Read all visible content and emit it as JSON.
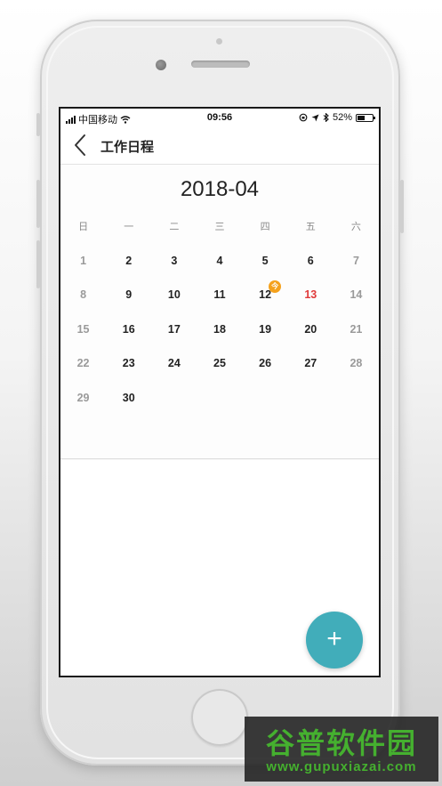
{
  "status_bar": {
    "carrier": "中国移动",
    "time": "09:56",
    "battery": "52%",
    "battery_level": 0.52
  },
  "nav": {
    "title": "工作日程"
  },
  "calendar": {
    "month": "2018-04",
    "weekdays": [
      "日",
      "一",
      "二",
      "三",
      "四",
      "五",
      "六"
    ],
    "weeks": [
      [
        {
          "d": "1",
          "s": "muted"
        },
        {
          "d": "2"
        },
        {
          "d": "3"
        },
        {
          "d": "4"
        },
        {
          "d": "5"
        },
        {
          "d": "6"
        },
        {
          "d": "7",
          "s": "muted"
        }
      ],
      [
        {
          "d": "8",
          "s": "muted"
        },
        {
          "d": "9"
        },
        {
          "d": "10"
        },
        {
          "d": "11"
        },
        {
          "d": "12",
          "badge": "今"
        },
        {
          "d": "13",
          "s": "red"
        },
        {
          "d": "14",
          "s": "muted"
        }
      ],
      [
        {
          "d": "15",
          "s": "muted"
        },
        {
          "d": "16"
        },
        {
          "d": "17"
        },
        {
          "d": "18"
        },
        {
          "d": "19"
        },
        {
          "d": "20"
        },
        {
          "d": "21",
          "s": "muted"
        }
      ],
      [
        {
          "d": "22",
          "s": "muted"
        },
        {
          "d": "23"
        },
        {
          "d": "24"
        },
        {
          "d": "25"
        },
        {
          "d": "26"
        },
        {
          "d": "27"
        },
        {
          "d": "28",
          "s": "muted"
        }
      ],
      [
        {
          "d": "29",
          "s": "muted"
        },
        {
          "d": "30"
        },
        {
          "d": ""
        },
        {
          "d": ""
        },
        {
          "d": ""
        },
        {
          "d": ""
        },
        {
          "d": ""
        }
      ]
    ]
  },
  "fab": {
    "label": "+"
  },
  "watermark": {
    "top": "谷普软件园",
    "bottom": "www.gupuxiazai.com"
  },
  "colors": {
    "accent": "#41adba",
    "today_badge": "#f5a11c",
    "highlight_red": "#e03a3a"
  },
  "icons": [
    "back-arrow-icon",
    "wifi-icon",
    "location-icon",
    "bluetooth-icon",
    "battery-icon",
    "plus-icon"
  ]
}
